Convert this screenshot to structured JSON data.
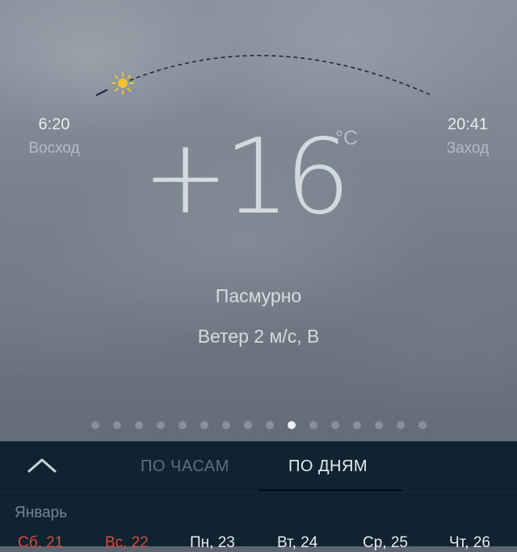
{
  "sun": {
    "sunrise_time": "6:20",
    "sunrise_label": "Восход",
    "sunset_time": "20:41",
    "sunset_label": "Заход",
    "sun_icon": "sun-icon"
  },
  "weather": {
    "temperature": "+16",
    "unit": "°C",
    "condition": "Пасмурно",
    "wind": "Ветер 2 м/с, В"
  },
  "pager": {
    "total": 16,
    "active_index": 9
  },
  "tabs": [
    {
      "label": "ПО ЧАСАМ",
      "active": false
    },
    {
      "label": "ПО ДНЯМ",
      "active": true
    }
  ],
  "collapse_icon": "chevron-up-icon",
  "forecast": {
    "month": "Январь",
    "days": [
      {
        "label": "Сб, 21",
        "weekend": true
      },
      {
        "label": "Вс, 22",
        "weekend": true
      },
      {
        "label": "Пн, 23",
        "weekend": false
      },
      {
        "label": "Вт, 24",
        "weekend": false
      },
      {
        "label": "Ср, 25",
        "weekend": false
      },
      {
        "label": "Чт, 26",
        "weekend": false
      }
    ]
  },
  "colors": {
    "panel_bg": "#0f2331",
    "weekend_red": "#d94c3f",
    "sun_yellow": "#f2c233"
  }
}
